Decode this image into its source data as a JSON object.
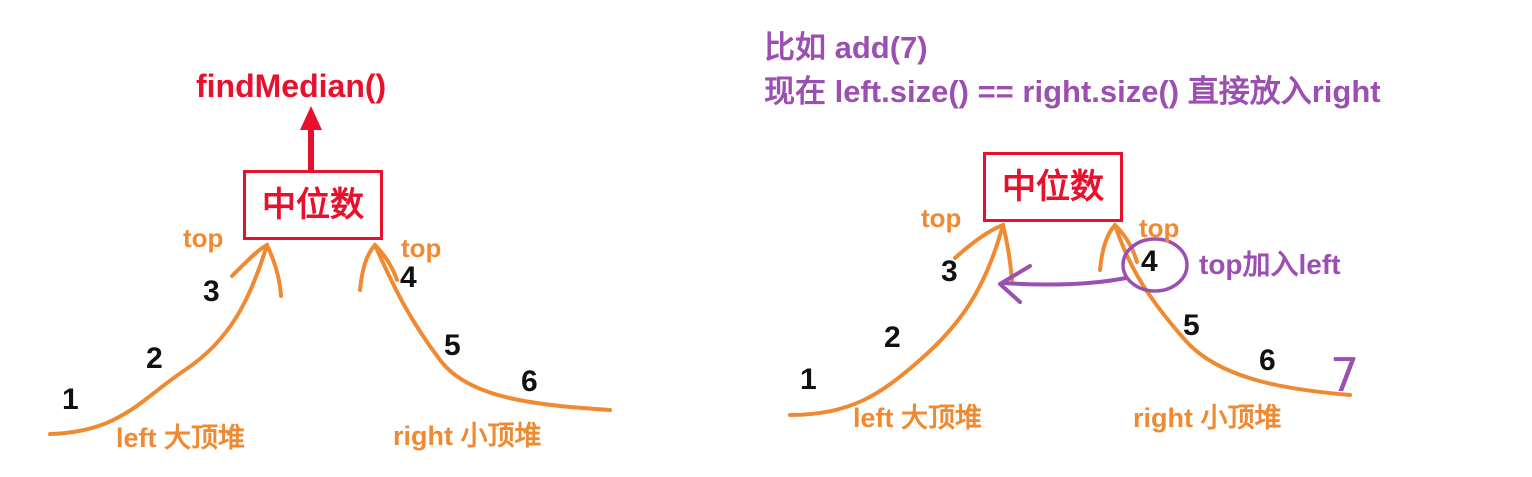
{
  "colors": {
    "heap_curve": "#f08a32",
    "box_and_arrow": "#e8112d",
    "annotation": "#9b4fb0",
    "numbers": "#111111"
  },
  "left_panel": {
    "function_call": "findMedian()",
    "median_label": "中位数",
    "left_top_label": "top",
    "right_top_label": "top",
    "left_heap_label": "left 大顶堆",
    "right_heap_label": "right 小顶堆",
    "left_heap_values": [
      "1",
      "2",
      "3"
    ],
    "right_heap_values": [
      "4",
      "5",
      "6"
    ]
  },
  "right_panel": {
    "note_line1": "比如 add(7)",
    "note_line2": "现在 left.size() == right.size() 直接放入right",
    "median_label": "中位数",
    "left_top_label": "top",
    "right_top_label": "top",
    "move_note": "top加入left",
    "left_heap_label": "left 大顶堆",
    "right_heap_label": "right 小顶堆",
    "left_heap_values": [
      "1",
      "2",
      "3"
    ],
    "right_heap_values": [
      "4",
      "5",
      "6"
    ],
    "added_value": "7"
  }
}
